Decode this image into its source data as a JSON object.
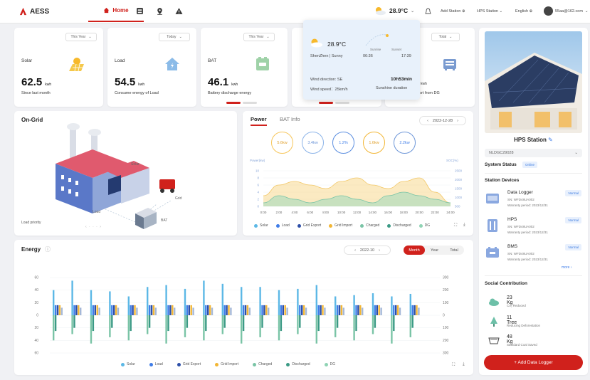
{
  "brand": {
    "name": "AESS"
  },
  "nav": {
    "home_label": "Home"
  },
  "header": {
    "temperature": "28.9°C",
    "add_station": "Add Station",
    "station": "HPS Station",
    "language": "English",
    "account": "55aa@162.com"
  },
  "stats": [
    {
      "label": "Solar",
      "value": "62.5",
      "unit": "kwh",
      "sub": "Since last month",
      "period": "This Year"
    },
    {
      "label": "Load",
      "value": "54.5",
      "unit": "kwh",
      "sub": "Consume energy of Load",
      "period": "Today"
    },
    {
      "label": "BAT",
      "value": "46.1",
      "unit": "kwh",
      "sub": "Battery discharge energy",
      "period": "This Year"
    },
    {
      "label": "",
      "value": "",
      "unit": "kwh",
      "sub": "port from DG",
      "period": "Total"
    }
  ],
  "weather_popup": {
    "temp": "28.9°C",
    "location": "ShenZhen | Sunny",
    "sunrise_label": "Sunrise",
    "sunset_label": "Sunset",
    "sunrise": "06:36",
    "sunset": "17:39",
    "wind_direction": "Wind direction: SE",
    "wind_speed": "Wind speed：25km/h",
    "sunshine": "10h53min",
    "sunshine_label": "Sunshine duration"
  },
  "ongrid": {
    "title": "On-Grid",
    "solar": "Solar",
    "grid": "Grid",
    "load": "Load",
    "bat": "BAT",
    "load_priority": "Load priority"
  },
  "power": {
    "tab_power": "Power",
    "tab_bat": "BAT Info",
    "date": "2022-12-28",
    "circles": [
      "5.6kw",
      "3.4kw",
      "1.2%",
      "1.6kw",
      "2.2kw"
    ],
    "ylabel_left": "Power(kw)",
    "ylabel_right": "SOC(%)"
  },
  "power_legend": [
    "Solar",
    "Load",
    "Grid Export",
    "Grid Import",
    "Charged",
    "Discharged",
    "DG"
  ],
  "energy": {
    "title": "Energy",
    "date": "2022-10",
    "tab_month": "Month",
    "tab_year": "Year",
    "tab_total": "Total"
  },
  "station": {
    "name": "HPS Station",
    "select": "NLDGC29028",
    "status_label": "System Status",
    "status": "Online",
    "devices_title": "Station Devices",
    "more": "more",
    "devices": [
      {
        "name": "Data Logger",
        "sn": "SN: WFD48UA002",
        "warranty": "Warranty period: 2023/12/31",
        "status": "Normal"
      },
      {
        "name": "HPS",
        "sn": "SN: WFD48UA002",
        "warranty": "Warranty period: 2023/12/31",
        "status": "Normal"
      },
      {
        "name": "BMS",
        "sn": "SN: WFD48UA002",
        "warranty": "Warranty period: 2023/12/31",
        "status": "Normal"
      }
    ],
    "social_title": "Social Contribution",
    "social": [
      {
        "value": "23 Kg",
        "label": "Co₂ Reduced"
      },
      {
        "value": "11 Tree",
        "label": "Reducing Deforestation"
      },
      {
        "value": "48 Kg",
        "label": "Standard Coal Saved"
      }
    ],
    "add_button": "+ Add Data Logger"
  },
  "chart_data": [
    {
      "type": "area",
      "x": [
        "0:00",
        "2:00",
        "4:00",
        "6:00",
        "8:00",
        "10:00",
        "12:00",
        "14:00",
        "16:00",
        "18:00",
        "20:00",
        "22:00",
        "24:00"
      ],
      "yticks_left": [
        0,
        2,
        4,
        6,
        8,
        10
      ],
      "yticks_right": [
        500,
        1000,
        1500,
        2000,
        2500
      ],
      "series": [
        {
          "name": "Solar",
          "values": [
            3,
            6,
            7,
            6,
            5,
            7,
            8,
            6,
            5,
            7,
            8,
            4,
            1
          ]
        },
        {
          "name": "Charged",
          "values": [
            1,
            3,
            2,
            1,
            2,
            3,
            2,
            1,
            3,
            4,
            3,
            2,
            1
          ]
        }
      ]
    },
    {
      "type": "bar",
      "ylim": [
        -60,
        60
      ],
      "yticks_left": [
        60,
        40,
        20,
        0,
        20,
        40,
        60
      ],
      "yticks_right": [
        300,
        200,
        100,
        0,
        100,
        200,
        300
      ],
      "groups": [
        {
          "up": [
            40,
            16,
            16,
            16,
            12
          ],
          "down": [
            -40,
            -25
          ]
        },
        {
          "up": [
            55,
            16,
            16,
            16,
            12
          ],
          "down": [
            -30,
            -20
          ]
        },
        {
          "up": [
            40,
            16,
            16,
            16,
            12
          ],
          "down": [
            -45,
            -25
          ]
        },
        {
          "up": [
            38,
            16,
            16,
            16,
            12
          ],
          "down": [
            -35,
            -20
          ]
        },
        {
          "up": [
            30,
            16,
            16,
            16,
            12
          ],
          "down": [
            -40,
            -25
          ]
        },
        {
          "up": [
            45,
            16,
            16,
            16,
            12
          ],
          "down": [
            -30,
            -20
          ]
        },
        {
          "up": [
            48,
            16,
            16,
            16,
            12
          ],
          "down": [
            -45,
            -25
          ]
        },
        {
          "up": [
            42,
            16,
            16,
            16,
            12
          ],
          "down": [
            -35,
            -20
          ]
        },
        {
          "up": [
            55,
            16,
            16,
            16,
            12
          ],
          "down": [
            -40,
            -25
          ]
        },
        {
          "up": [
            50,
            16,
            16,
            16,
            12
          ],
          "down": [
            -30,
            -20
          ]
        },
        {
          "up": [
            45,
            16,
            16,
            16,
            12
          ],
          "down": [
            -45,
            -25
          ]
        },
        {
          "up": [
            45,
            16,
            16,
            16,
            12
          ],
          "down": [
            -35,
            -20
          ]
        },
        {
          "up": [
            40,
            16,
            16,
            16,
            12
          ],
          "down": [
            -40,
            -25
          ]
        },
        {
          "up": [
            42,
            16,
            16,
            16,
            12
          ],
          "down": [
            -30,
            -20
          ]
        },
        {
          "up": [
            48,
            16,
            16,
            16,
            12
          ],
          "down": [
            -45,
            -25
          ]
        },
        {
          "up": [
            30,
            16,
            16,
            16,
            12
          ],
          "down": [
            -35,
            -20
          ]
        },
        {
          "up": [
            32,
            16,
            16,
            16,
            12
          ],
          "down": [
            -40,
            -25
          ]
        },
        {
          "up": [
            35,
            16,
            16,
            16,
            12
          ],
          "down": [
            -30,
            -20
          ]
        },
        {
          "up": [
            30,
            16,
            16,
            16,
            12
          ],
          "down": [
            -45,
            -25
          ]
        },
        {
          "up": [
            34,
            16,
            16,
            16,
            12
          ],
          "down": [
            -35,
            -20
          ]
        }
      ]
    }
  ],
  "energy_legend": [
    "Solar",
    "Load",
    "Grid Export",
    "Grid Import",
    "Charged",
    "Discharged",
    "DG"
  ],
  "colors": {
    "accent": "#d0211c",
    "solar": "#5cb8e6",
    "load": "#3f7de8",
    "grid_export": "#2d4fa8",
    "grid_import": "#f2b634",
    "charged": "#7ac4a6",
    "discharged": "#3b9a85",
    "dg": "#8fd3b4"
  }
}
